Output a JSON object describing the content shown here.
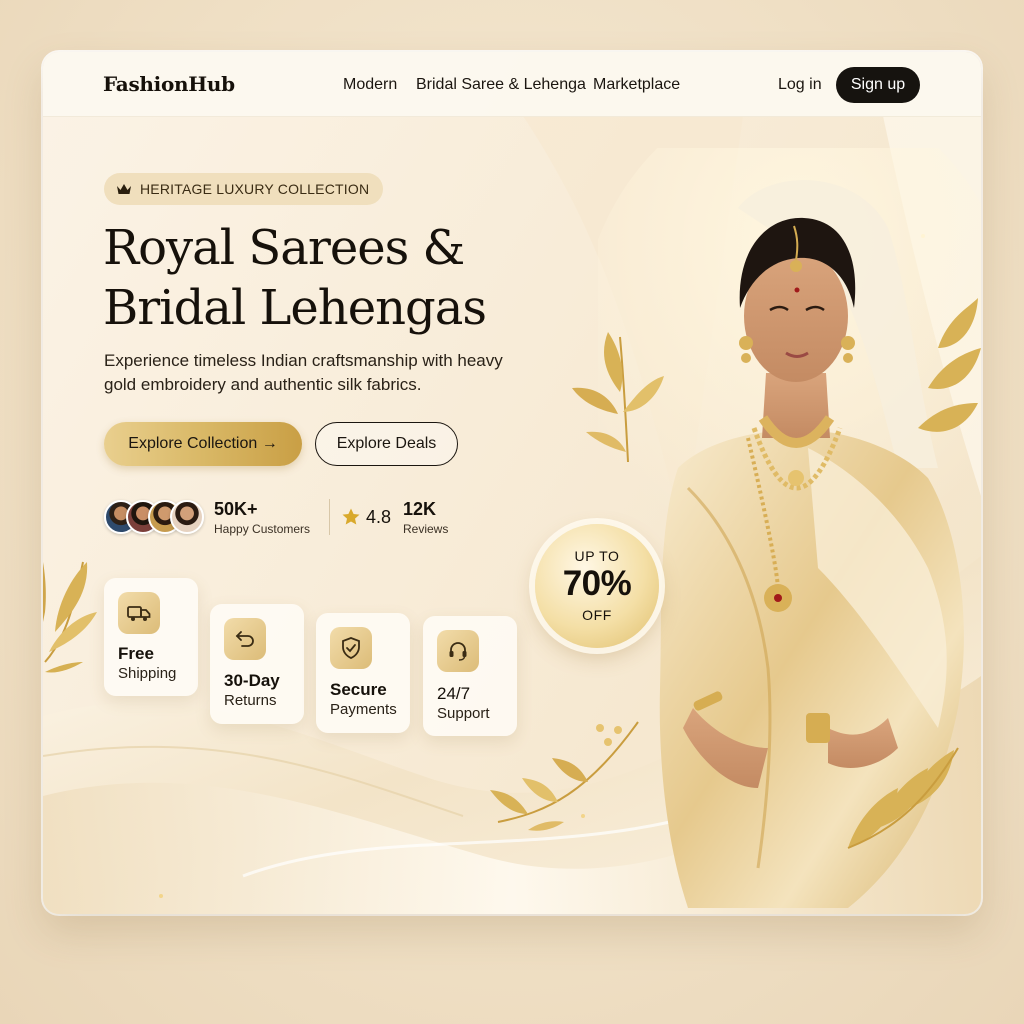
{
  "header": {
    "logo": "FashionHub",
    "nav": [
      "Modern",
      "Bridal Saree & Lehenga",
      "Marketplace"
    ],
    "login": "Log in",
    "signup": "Sign up"
  },
  "hero": {
    "badge": "HERITAGE LUXURY COLLECTION",
    "badge_icon": "crown-icon",
    "title_line1": "Royal Sarees &",
    "title_line2": "Bridal Lehengas",
    "subtitle": "Experience timeless Indian craftsmanship with heavy gold embroidery and authentic silk fabrics.",
    "primary_cta": "Explore Collection →",
    "secondary_cta": "Explore Deals"
  },
  "stats": {
    "customers_value": "50K+",
    "customers_label": "Happy Customers",
    "rating": "4.8",
    "reviews_value": "12K",
    "reviews_label": "Reviews"
  },
  "features": [
    {
      "title": "Free",
      "subtitle": "Shipping",
      "icon": "truck-icon"
    },
    {
      "title": "30-Day",
      "subtitle": "Returns",
      "icon": "return-arrow-icon"
    },
    {
      "title": "Secure",
      "subtitle": "Payments",
      "icon": "shield-check-icon"
    },
    {
      "title": "24/7",
      "subtitle": "Support",
      "icon": "headset-icon"
    }
  ],
  "discount": {
    "line1": "UP TO",
    "line2": "70%",
    "line3": "OFF"
  },
  "colors": {
    "gold": "#d9b866",
    "dark": "#16130f",
    "cream": "#fbf3e6"
  }
}
